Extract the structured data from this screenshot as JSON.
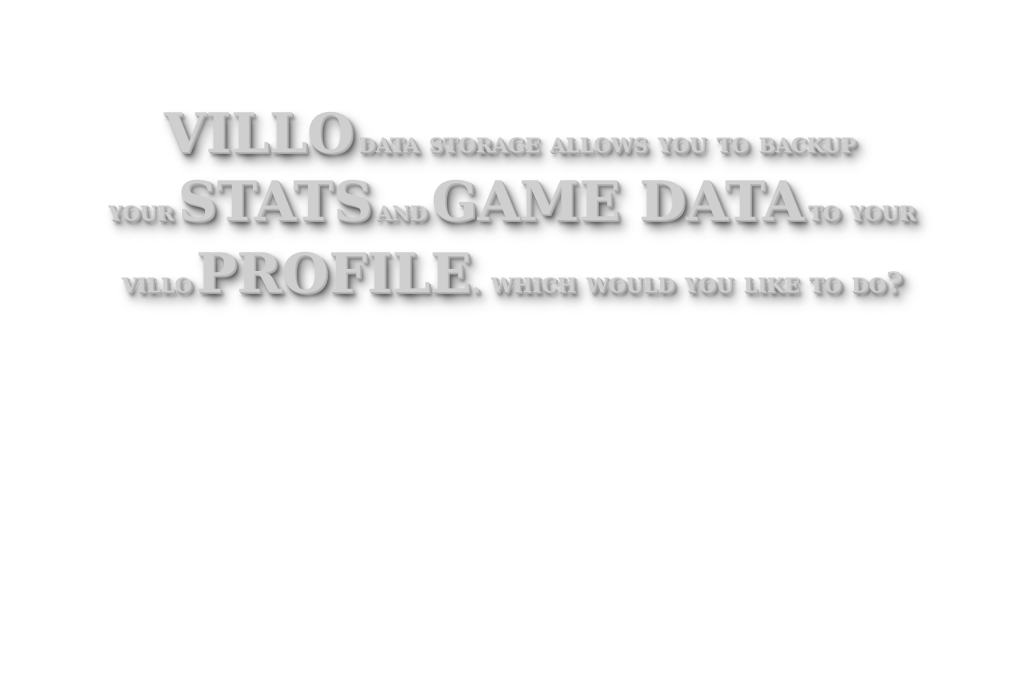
{
  "message": {
    "line1": {
      "big1": "VILLO",
      "small1": "DATA STORAGE ALLOWS YOU TO BACKUP"
    },
    "line2": {
      "small1": "YOUR",
      "big1": "STATS",
      "small2": "AND",
      "big2": "GAME DATA",
      "small3": "TO YOUR"
    },
    "line3": {
      "small1": "VILLO",
      "big1": "PROFILE",
      "small2": ". WHICH WOULD YOU LIKE TO DO?"
    }
  },
  "colors": {
    "background": "#ffffff",
    "text": "#cfcfcf",
    "shadow": "#404040"
  }
}
